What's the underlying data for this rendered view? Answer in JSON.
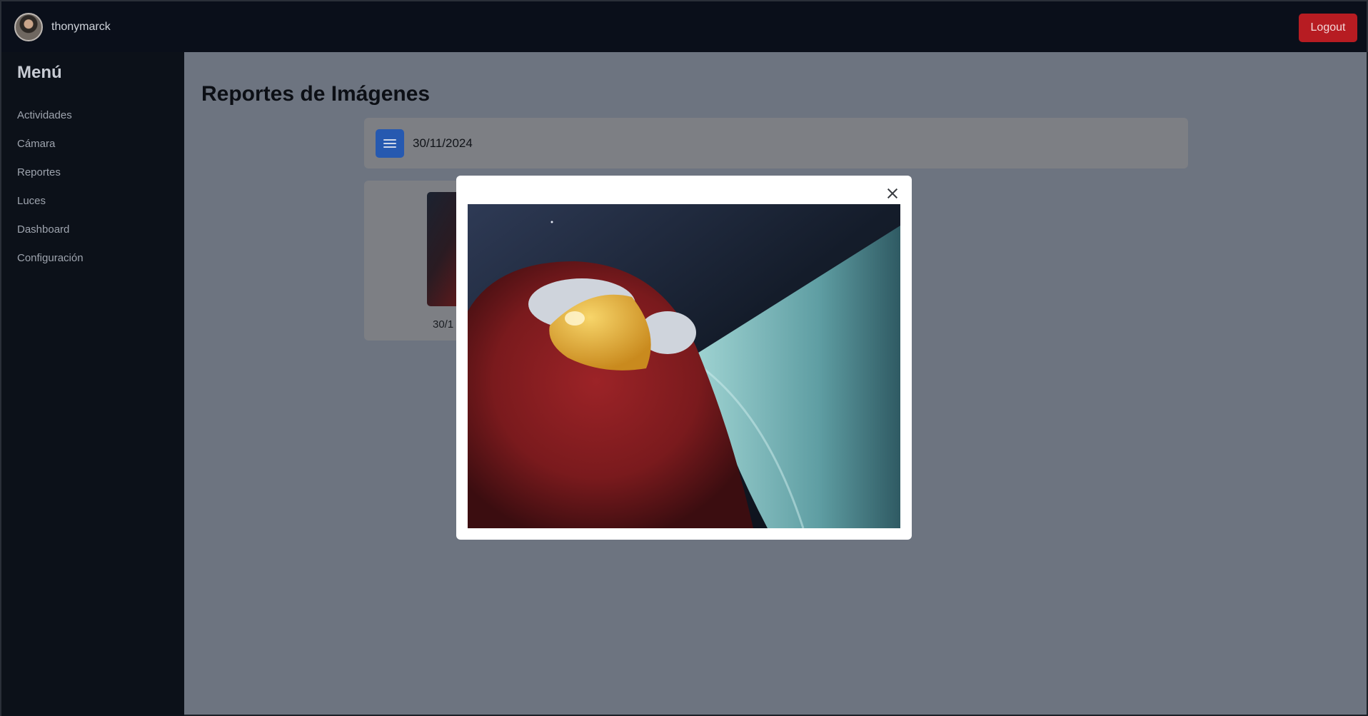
{
  "header": {
    "username": "thonymarck",
    "logout_label": "Logout",
    "logout_color": "#b71c22"
  },
  "sidebar": {
    "title": "Menú",
    "items": [
      {
        "label": "Actividades"
      },
      {
        "label": "Cámara"
      },
      {
        "label": "Reportes"
      },
      {
        "label": "Luces"
      },
      {
        "label": "Dashboard"
      },
      {
        "label": "Configuración"
      }
    ]
  },
  "main": {
    "title": "Reportes de Imágenes",
    "date_group": {
      "toggle_icon": "menu-icon",
      "date": "30/11/2024"
    },
    "thumbnail": {
      "caption": "30/1"
    }
  },
  "modal": {
    "close_icon": "close-icon"
  }
}
